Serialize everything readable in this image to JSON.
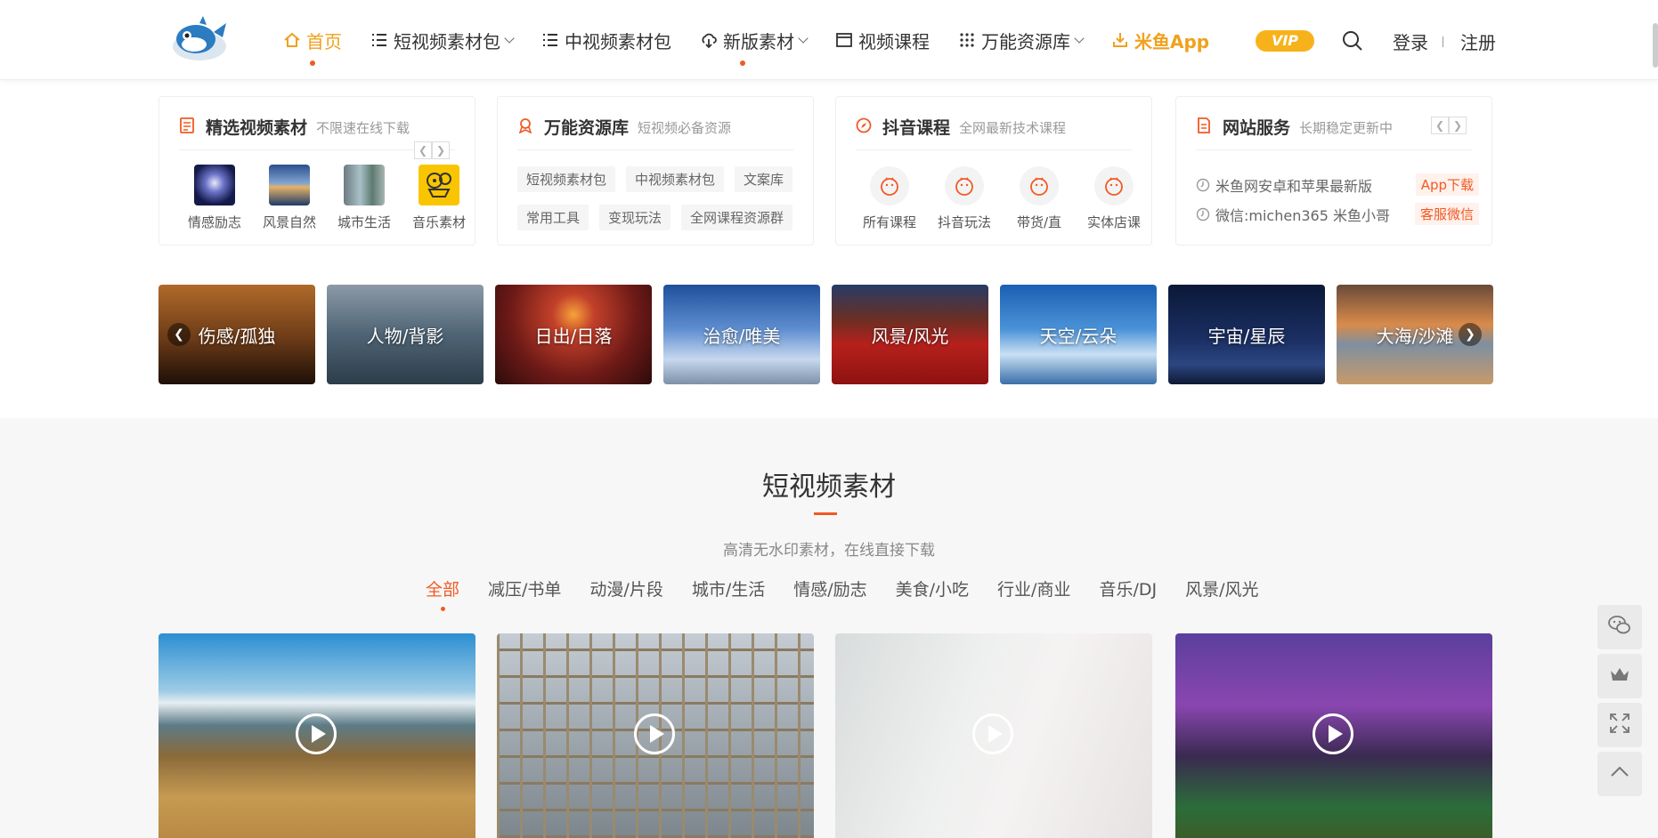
{
  "header": {
    "nav": [
      {
        "label": "首页",
        "icon": "home-icon",
        "active": true
      },
      {
        "label": "短视频素材包",
        "icon": "list-icon",
        "dropdown": true
      },
      {
        "label": "中视频素材包",
        "icon": "list-icon"
      },
      {
        "label": "新版素材",
        "icon": "cloud-download-icon",
        "dropdown": true,
        "dot": true
      },
      {
        "label": "视频课程",
        "icon": "window-icon"
      },
      {
        "label": "万能资源库",
        "icon": "grid-dots-icon",
        "dropdown": true
      },
      {
        "label": "米鱼App",
        "icon": "download-icon"
      }
    ],
    "vip": "VIP",
    "login": "登录",
    "register": "注册"
  },
  "cards": {
    "featured": {
      "title": "精选视频素材",
      "subtitle": "不限速在线下载",
      "items": [
        "情感励志",
        "风景自然",
        "城市生活",
        "音乐素材"
      ]
    },
    "resources": {
      "title": "万能资源库",
      "subtitle": "短视频必备资源",
      "tags": [
        "短视频素材包",
        "中视频素材包",
        "文案库",
        "常用工具",
        "变现玩法",
        "全网课程资源群"
      ]
    },
    "courses": {
      "title": "抖音课程",
      "subtitle": "全网最新技术课程",
      "items": [
        "所有课程",
        "抖音玩法",
        "带货/直",
        "实体店课"
      ]
    },
    "service": {
      "title": "网站服务",
      "subtitle": "长期稳定更新中",
      "rows": [
        {
          "text": "米鱼网安卓和苹果最新版",
          "button": "App下载"
        },
        {
          "text": "微信:michen365 米鱼小哥",
          "button": "客服微信"
        }
      ]
    }
  },
  "banners": [
    "伤感/孤独",
    "人物/背影",
    "日出/日落",
    "治愈/唯美",
    "风景/风光",
    "天空/云朵",
    "宇宙/星辰",
    "大海/沙滩"
  ],
  "section": {
    "title": "短视频素材",
    "subtitle": "高清无水印素材，在线直接下载",
    "filters": [
      "全部",
      "减压/书单",
      "动漫/片段",
      "城市/生活",
      "情感/励志",
      "美食/小吃",
      "行业/商业",
      "音乐/DJ",
      "风景/风光"
    ]
  },
  "colors": {
    "accent": "#f15a24",
    "gold": "#f0a11e",
    "vip": "#f7b21b"
  }
}
